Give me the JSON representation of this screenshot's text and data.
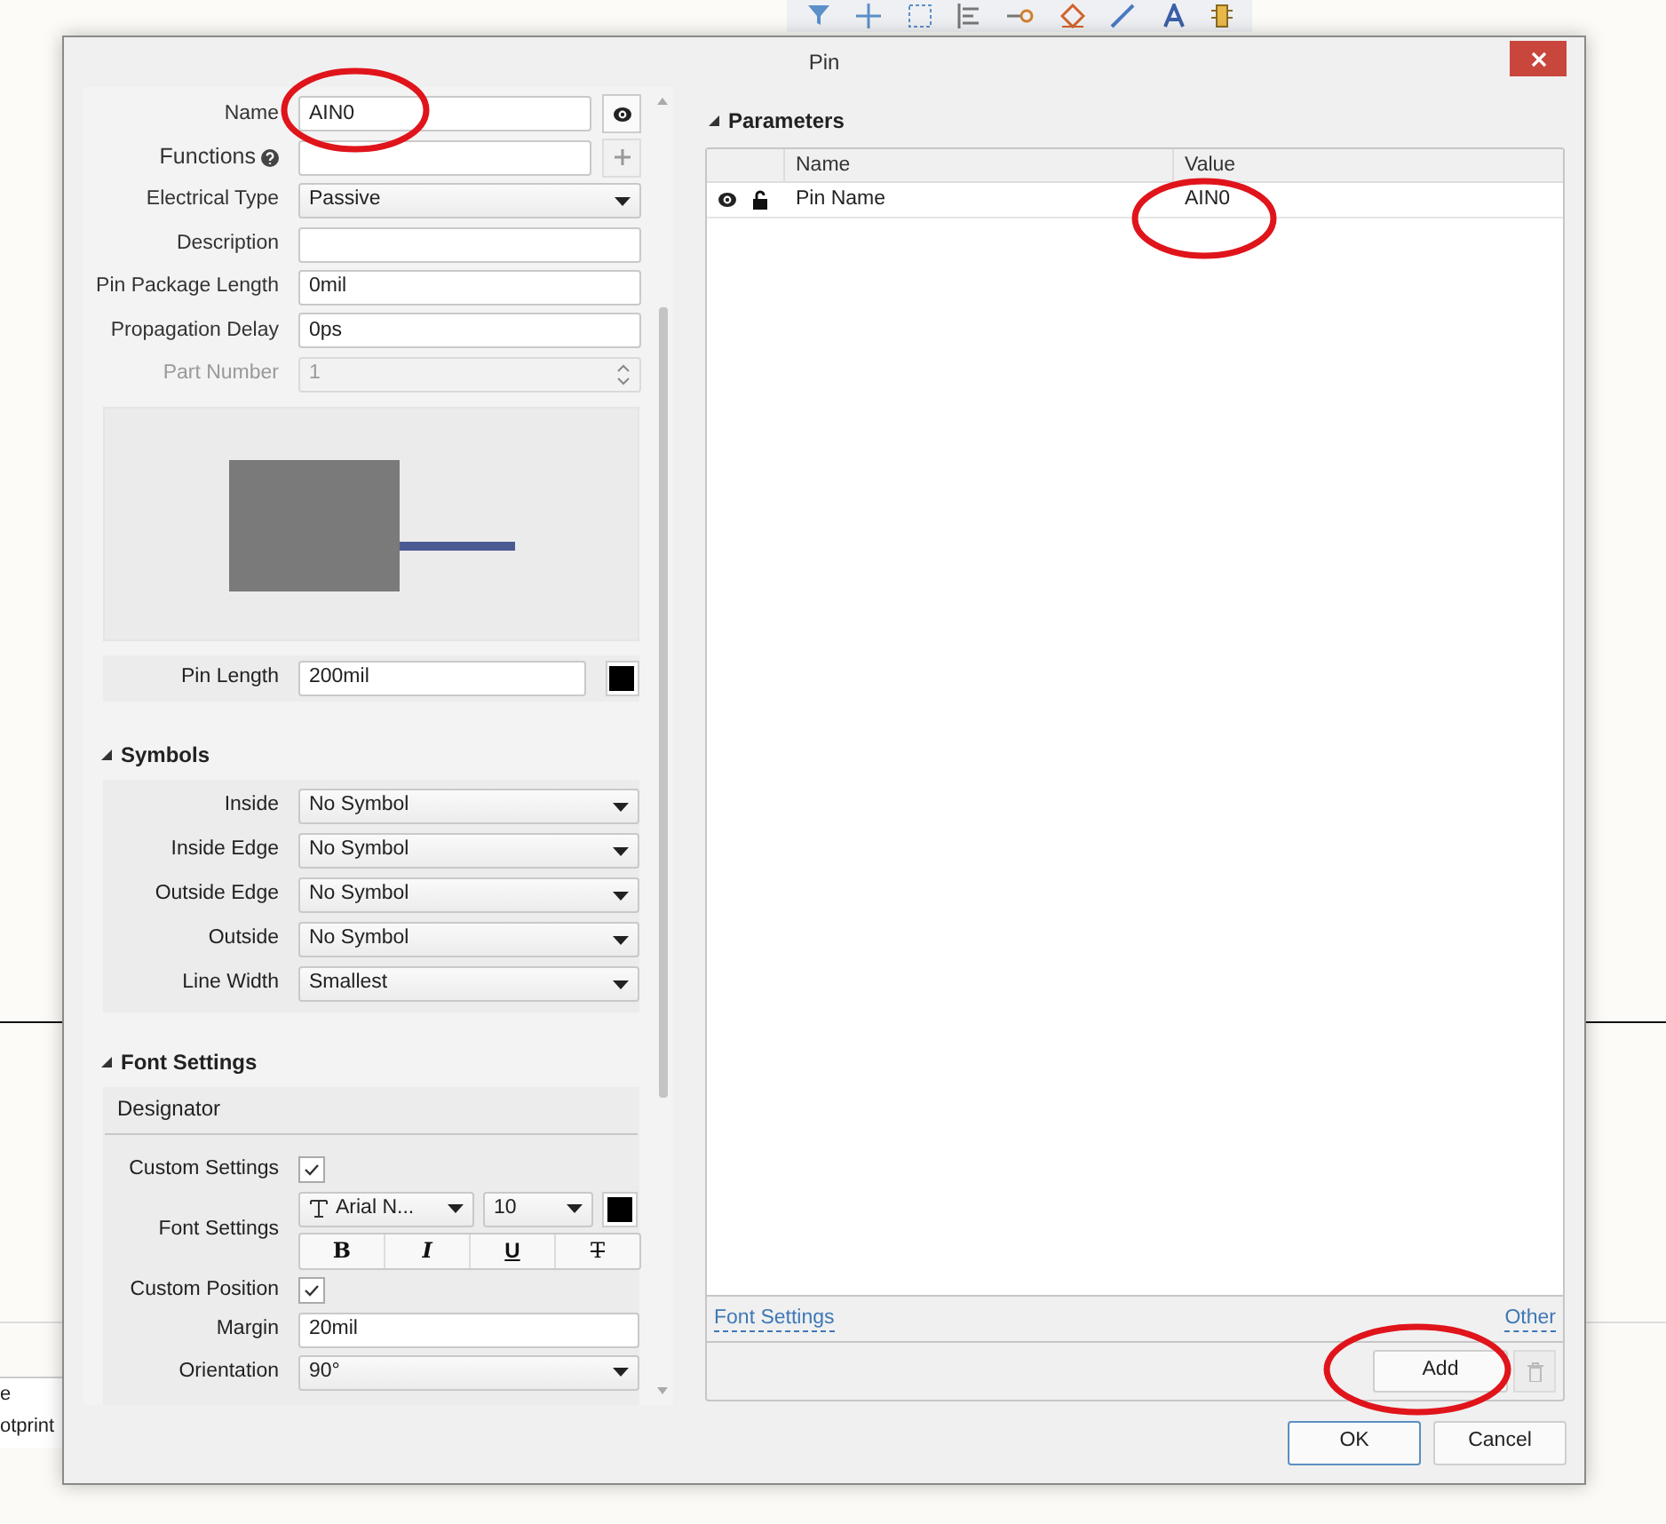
{
  "background": {
    "texts": [
      "e",
      "otprint"
    ]
  },
  "dialog": {
    "title": "Pin",
    "properties": [
      {
        "kind": "input",
        "label": "Name",
        "value": "AIN0",
        "visibility_toggle": true
      },
      {
        "kind": "input",
        "label": "Functions",
        "add_button": true,
        "help": true
      },
      {
        "kind": "select",
        "label": "Electrical Type",
        "value": "Passive"
      },
      {
        "kind": "input",
        "label": "Description"
      },
      {
        "kind": "input",
        "label": "Pin Package Length",
        "value": "0mil"
      },
      {
        "kind": "input",
        "label": "Propagation Delay",
        "value": "0ps"
      },
      {
        "kind": "spinner",
        "label": "Part Number",
        "value": "1",
        "disabled": true
      }
    ],
    "pin_length": {
      "label": "Pin Length",
      "value": "200mil",
      "color": "#000000"
    },
    "symbols": {
      "title": "Symbols",
      "expanded": true,
      "rows": [
        {
          "label": "Inside",
          "value": "No Symbol"
        },
        {
          "label": "Inside Edge",
          "value": "No Symbol"
        },
        {
          "label": "Outside Edge",
          "value": "No Symbol"
        },
        {
          "label": "Outside",
          "value": "No Symbol"
        },
        {
          "label": "Line Width",
          "value": "Smallest"
        }
      ]
    },
    "font_settings": {
      "title": "Font Settings",
      "expanded": true,
      "subsection": "Designator",
      "custom_settings": {
        "label": "Custom Settings",
        "checked": true
      },
      "font": {
        "label": "Font Settings",
        "family": "Arial N...",
        "size": "10",
        "color": "#000000",
        "styles": [
          {
            "kind": "bold",
            "label": "B"
          },
          {
            "kind": "italic",
            "label": "I"
          },
          {
            "kind": "underline",
            "label": "U"
          },
          {
            "kind": "strike",
            "label": "T"
          }
        ]
      },
      "custom_position": {
        "label": "Custom Position",
        "checked": true
      },
      "margin": {
        "label": "Margin",
        "value": "20mil"
      },
      "orientation": {
        "label": "Orientation",
        "value": "90°"
      }
    },
    "parameters": {
      "title": "Parameters",
      "expanded": true,
      "columns": [
        "Name",
        "Value"
      ],
      "rows": [
        {
          "name": "Pin Name",
          "value": "AIN0"
        }
      ],
      "links": [
        "Font Settings",
        "Other"
      ],
      "add_button": "Add",
      "delete_disabled": true
    },
    "buttons": [
      {
        "label": "OK",
        "default": true
      },
      {
        "label": "Cancel",
        "default": false
      }
    ]
  }
}
